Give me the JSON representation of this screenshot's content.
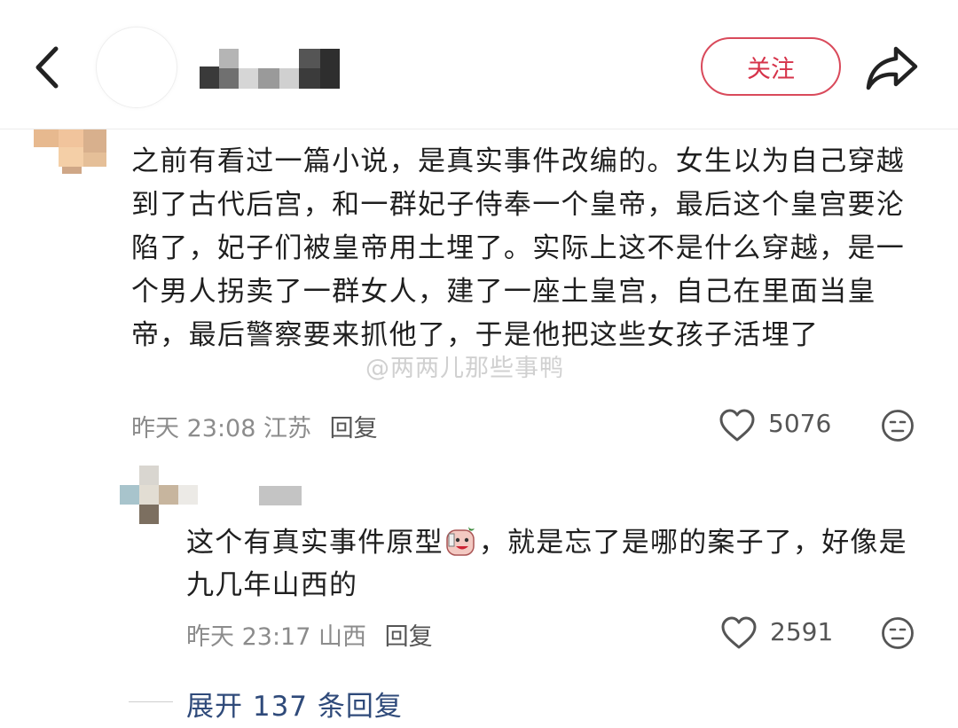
{
  "header": {
    "follow_label": "关注"
  },
  "comments": [
    {
      "text": "之前有看过一篇小说，是真实事件改编的。女生以为自己穿越到了古代后宫，和一群妃子侍奉一个皇帝，最后这个皇宫要沦陷了，妃子们被皇帝用土埋了。实际上这不是什么穿越，是一个男人拐卖了一群女人，建了一座土皇宫，自己在里面当皇帝，最后警察要来抓他了，于是他把这些女孩子活埋了",
      "time": "昨天 23:08",
      "location": "江苏",
      "reply_label": "回复",
      "likes": "5076"
    },
    {
      "text_before": "这个有真实事件原型",
      "text_after": "，就是忘了是哪的案子了，好像是九几年山西的",
      "sticker_icon": "laughing-sticker-icon",
      "time": "昨天 23:17",
      "location": "山西",
      "reply_label": "回复",
      "likes": "2591"
    }
  ],
  "watermark": "@两两儿那些事鸭",
  "expand_label": "展开 137 条回复",
  "colors": {
    "follow_accent": "#d6334a",
    "expand_link": "#2f4a7a",
    "meta_gray": "#8c8c8c"
  }
}
